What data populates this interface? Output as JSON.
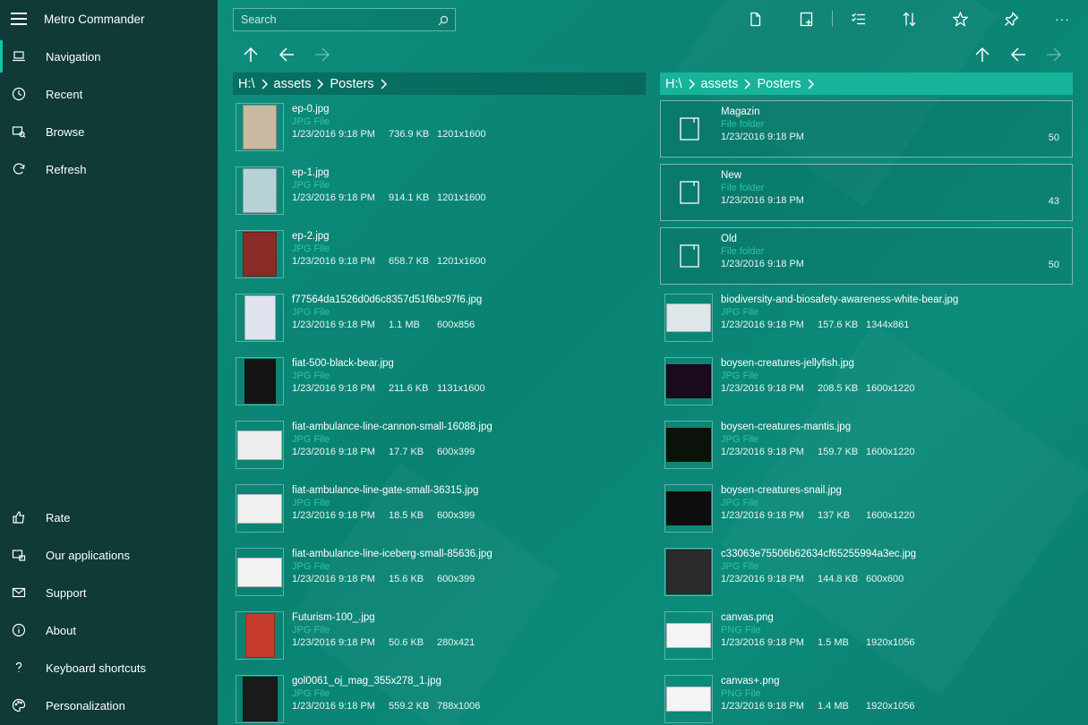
{
  "app": {
    "title": "Metro Commander"
  },
  "sidebar": {
    "top_items": [
      {
        "label": "Navigation",
        "icon": "laptop-icon",
        "active": true
      },
      {
        "label": "Recent",
        "icon": "clock-icon"
      },
      {
        "label": "Browse",
        "icon": "browse-icon"
      },
      {
        "label": "Refresh",
        "icon": "refresh-icon"
      }
    ],
    "bottom_items": [
      {
        "label": "Rate",
        "icon": "thumbs-up-icon"
      },
      {
        "label": "Our applications",
        "icon": "store-icon"
      },
      {
        "label": "Support",
        "icon": "mail-icon"
      },
      {
        "label": "About",
        "icon": "info-icon"
      },
      {
        "label": "Keyboard shortcuts",
        "icon": "question-icon"
      },
      {
        "label": "Personalization",
        "icon": "palette-icon"
      }
    ]
  },
  "search": {
    "placeholder": "Search"
  },
  "toolbar": [
    "new-file-icon",
    "new-folder-icon",
    "select-icon",
    "sort-icon",
    "favorite-icon",
    "pin-icon",
    "more-icon"
  ],
  "toolbar_more": "···",
  "left_pane": {
    "breadcrumb": [
      "H:\\",
      "assets",
      "Posters"
    ],
    "files": [
      {
        "name": "ep-0.jpg",
        "type": "JPG File",
        "date": "1/23/2016 9:18 PM",
        "size": "736.9 KB",
        "dims": "1201x1600",
        "color": "#c9b9a0"
      },
      {
        "name": "ep-1.jpg",
        "type": "JPG File",
        "date": "1/23/2016 9:18 PM",
        "size": "914.1 KB",
        "dims": "1201x1600",
        "color": "#b7d3d6"
      },
      {
        "name": "ep-2.jpg",
        "type": "JPG File",
        "date": "1/23/2016 9:18 PM",
        "size": "658.7 KB",
        "dims": "1201x1600",
        "color": "#8a2b28"
      },
      {
        "name": "f77564da1526d0d6c8357d51f6bc97f6.jpg",
        "type": "JPG File",
        "date": "1/23/2016 9:18 PM",
        "size": "1.1 MB",
        "dims": "600x856",
        "color": "#dfe3ee"
      },
      {
        "name": "fiat-500-black-bear.jpg",
        "type": "JPG File",
        "date": "1/23/2016 9:18 PM",
        "size": "211.6 KB",
        "dims": "1131x1600",
        "color": "#151515"
      },
      {
        "name": "fiat-ambulance-line-cannon-small-16088.jpg",
        "type": "JPG File",
        "date": "1/23/2016 9:18 PM",
        "size": "17.7 KB",
        "dims": "600x399",
        "color": "#eeeeee"
      },
      {
        "name": "fiat-ambulance-line-gate-small-36315.jpg",
        "type": "JPG File",
        "date": "1/23/2016 9:18 PM",
        "size": "18.5 KB",
        "dims": "600x399",
        "color": "#f0f0f0"
      },
      {
        "name": "fiat-ambulance-line-iceberg-small-85636.jpg",
        "type": "JPG File",
        "date": "1/23/2016 9:18 PM",
        "size": "15.6 KB",
        "dims": "600x399",
        "color": "#f2f2f2"
      },
      {
        "name": "Futurism-100_.jpg",
        "type": "JPG File",
        "date": "1/23/2016 9:18 PM",
        "size": "50.6 KB",
        "dims": "280x421",
        "color": "#c43b2e"
      },
      {
        "name": "gol0061_oj_mag_355x278_1.jpg",
        "type": "JPG File",
        "date": "1/23/2016 9:18 PM",
        "size": "559.2 KB",
        "dims": "788x1006",
        "color": "#1a1a1a"
      }
    ]
  },
  "right_pane": {
    "breadcrumb": [
      "H:\\",
      "assets",
      "Posters"
    ],
    "folders": [
      {
        "name": "Magazin",
        "type": "File folder",
        "date": "1/23/2016 9:18 PM",
        "count": "50"
      },
      {
        "name": "New",
        "type": "File folder",
        "date": "1/23/2016 9:18 PM",
        "count": "43"
      },
      {
        "name": "Old",
        "type": "File folder",
        "date": "1/23/2016 9:18 PM",
        "count": "50"
      }
    ],
    "files": [
      {
        "name": "biodiversity-and-biosafety-awareness-white-bear.jpg",
        "type": "JPG File",
        "date": "1/23/2016 9:18 PM",
        "size": "157.6 KB",
        "dims": "1344x861",
        "color": "#dfe6e9"
      },
      {
        "name": "boysen-creatures-jellyfish.jpg",
        "type": "JPG File",
        "date": "1/23/2016 9:18 PM",
        "size": "208.5 KB",
        "dims": "1600x1220",
        "color": "#1b0a1e"
      },
      {
        "name": "boysen-creatures-mantis.jpg",
        "type": "JPG File",
        "date": "1/23/2016 9:18 PM",
        "size": "159.7 KB",
        "dims": "1600x1220",
        "color": "#0a120a"
      },
      {
        "name": "boysen-creatures-snail.jpg",
        "type": "JPG File",
        "date": "1/23/2016 9:18 PM",
        "size": "137 KB",
        "dims": "1600x1220",
        "color": "#0d0d0d"
      },
      {
        "name": "c33063e75506b62634cf65255994a3ec.jpg",
        "type": "JPG File",
        "date": "1/23/2016 9:18 PM",
        "size": "144.8 KB",
        "dims": "600x600",
        "color": "#2b2b2b"
      },
      {
        "name": "canvas.png",
        "type": "PNG File",
        "date": "1/23/2016 9:18 PM",
        "size": "1.5 MB",
        "dims": "1920x1056",
        "color": "#f4f4f4"
      },
      {
        "name": "canvas+.png",
        "type": "PNG File",
        "date": "1/23/2016 9:18 PM",
        "size": "1.4 MB",
        "dims": "1920x1056",
        "color": "#f4f4f4"
      }
    ]
  }
}
